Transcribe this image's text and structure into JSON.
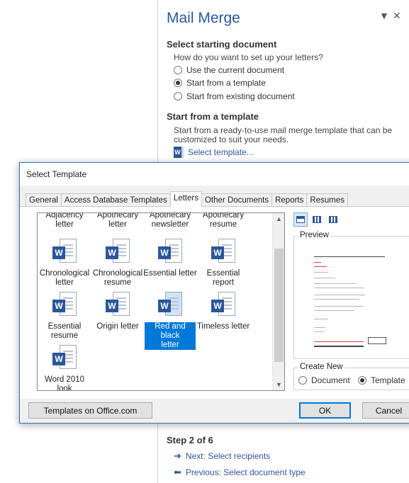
{
  "pane": {
    "title": "Mail Merge",
    "select_start_heading": "Select starting document",
    "question": "How do you want to set up your letters?",
    "options": [
      {
        "label": "Use the current document",
        "selected": false
      },
      {
        "label": "Start from a template",
        "selected": true
      },
      {
        "label": "Start from existing document",
        "selected": false
      }
    ],
    "template_heading": "Start from a template",
    "template_desc_line1": "Start from a ready-to-use mail merge template that can be",
    "template_desc_line2": "customized to suit your needs.",
    "select_template_link": "Select template...",
    "step": "Step 2 of 6",
    "next_link": "Next: Select recipients",
    "prev_link": "Previous: Select document type"
  },
  "dialog": {
    "title": "Select Template",
    "tabs": [
      "General",
      "Access Database Templates",
      "Letters",
      "Other Documents",
      "Reports",
      "Resumes"
    ],
    "active_tab": "Letters",
    "items_top_row": [
      [
        "Adjacency",
        "letter"
      ],
      [
        "Apothecary",
        "letter"
      ],
      [
        "Apothecary",
        "newsletter"
      ],
      [
        "Apothecary",
        "resume"
      ]
    ],
    "items": [
      {
        "line1": "Chronological",
        "line2": "letter"
      },
      {
        "line1": "Chronological",
        "line2": "resume"
      },
      {
        "line1": "Essential letter",
        "line2": ""
      },
      {
        "line1": "Essential",
        "line2": "report"
      },
      {
        "line1": "Essential",
        "line2": "resume"
      },
      {
        "line1": "Origin letter",
        "line2": ""
      },
      {
        "line1": "Red and black",
        "line2": "letter",
        "selected": true
      },
      {
        "line1": "Timeless letter",
        "line2": ""
      },
      {
        "line1": "Word 2010",
        "line2": "look"
      }
    ],
    "preview_label": "Preview",
    "create_new_label": "Create New",
    "create_new_options": [
      {
        "label": "Document",
        "selected": false
      },
      {
        "label": "Template",
        "selected": true
      }
    ],
    "templates_online_button": "Templates on Office.com",
    "ok_button": "OK",
    "cancel_button": "Cancel"
  },
  "icons": {
    "word": "W",
    "arrow_right": "➜",
    "arrow_left": "⬅",
    "dropdown": "▼",
    "close": "✕"
  },
  "colors": {
    "accent": "#2b579a",
    "selection": "#0078d7"
  }
}
